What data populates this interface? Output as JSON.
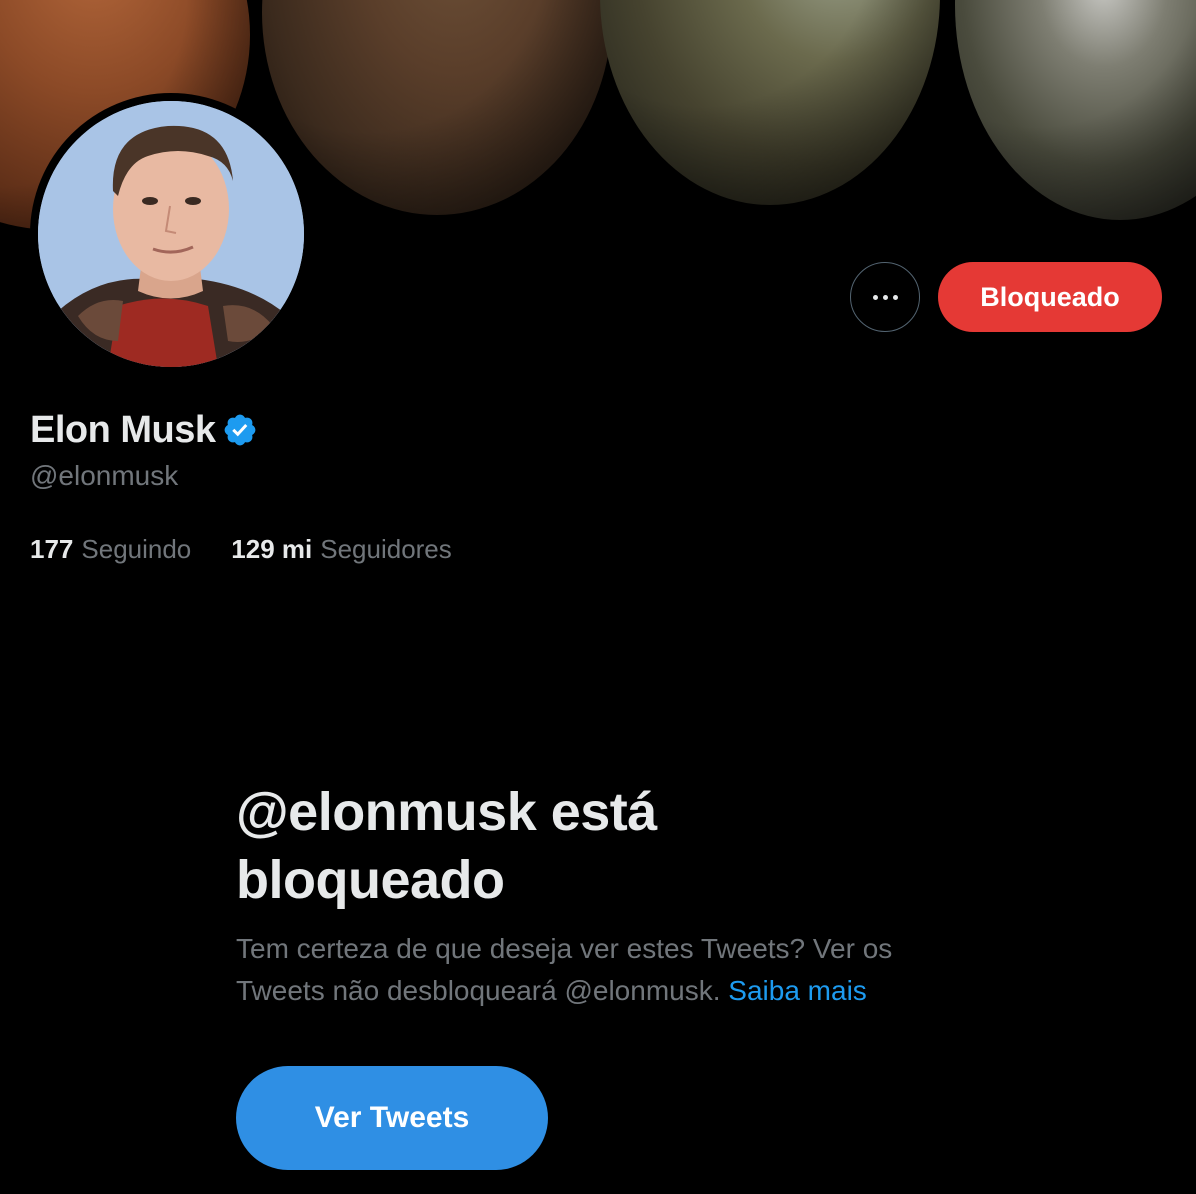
{
  "banner": {
    "image": "planets-terraforming-banner"
  },
  "avatar": {
    "image": "profile-photo"
  },
  "actions": {
    "more_icon": "more-horizontal-icon",
    "blocked_label": "Bloqueado"
  },
  "profile": {
    "display_name": "Elon Musk",
    "verified_icon": "verified-badge-icon",
    "handle": "@elonmusk",
    "following_count": "177",
    "following_label": "Seguindo",
    "followers_count": "129 mi",
    "followers_label": "Seguidores"
  },
  "notice": {
    "title": "@elonmusk está bloqueado",
    "description": "Tem certeza de que deseja ver estes Tweets? Ver os Tweets não desbloqueará @elonmusk.",
    "learn_more": "Saiba mais",
    "view_button": "Ver Tweets"
  },
  "colors": {
    "background": "#000000",
    "blocked_button": "#e53935",
    "accent_blue": "#1d9bf0",
    "muted_text": "#71767b",
    "primary_text": "#e7e9ea"
  }
}
